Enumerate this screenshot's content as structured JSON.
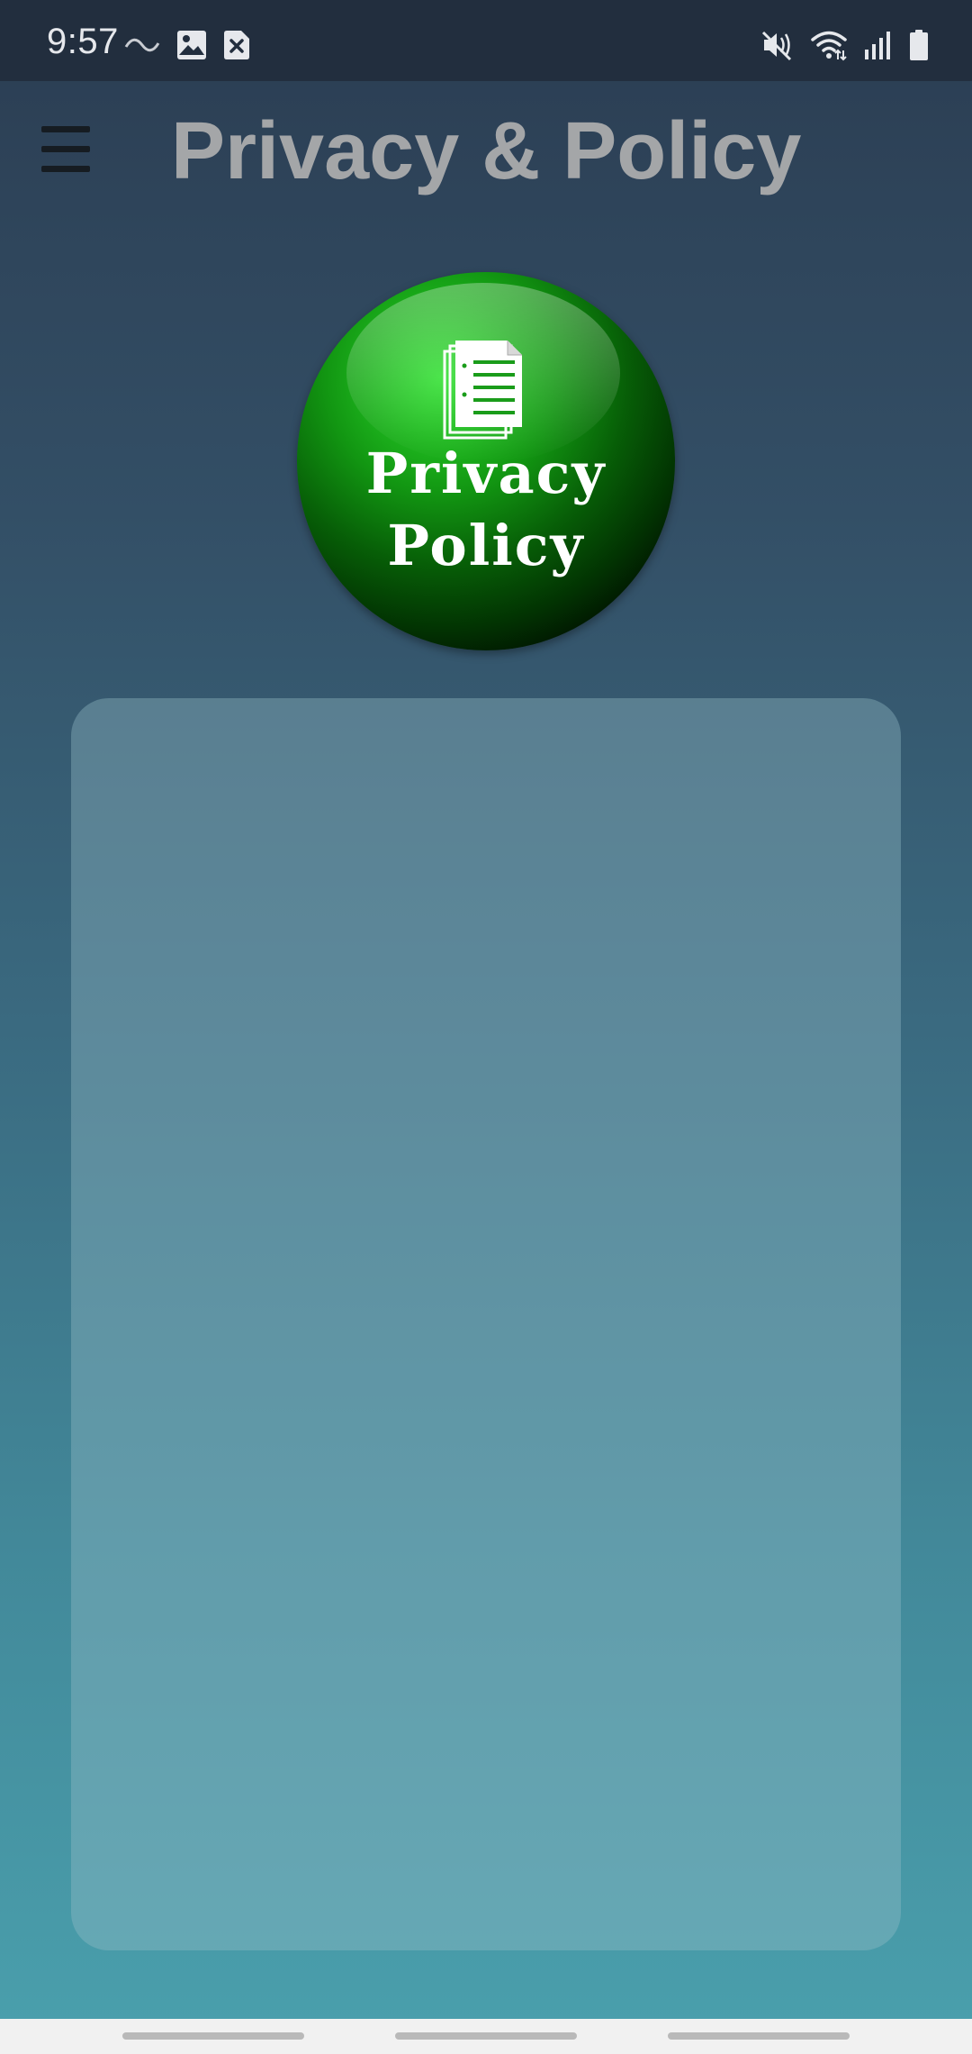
{
  "status_bar": {
    "time": "9:57",
    "left_icons": [
      "wave-icon",
      "image-icon",
      "sim-error-icon"
    ],
    "right_icons": [
      "mute-icon",
      "wifi-icon",
      "signal-icon",
      "battery-icon"
    ]
  },
  "app_bar": {
    "menu_icon": "hamburger-menu-icon",
    "title": "Privacy & Policy"
  },
  "logo": {
    "line1": "Privacy",
    "line2": "Policy",
    "icon": "document-icon",
    "color": "#22c022"
  },
  "content_card": {
    "text": ""
  },
  "nav_bar": {
    "items": [
      "recents-gesture",
      "home-gesture",
      "back-gesture"
    ]
  }
}
